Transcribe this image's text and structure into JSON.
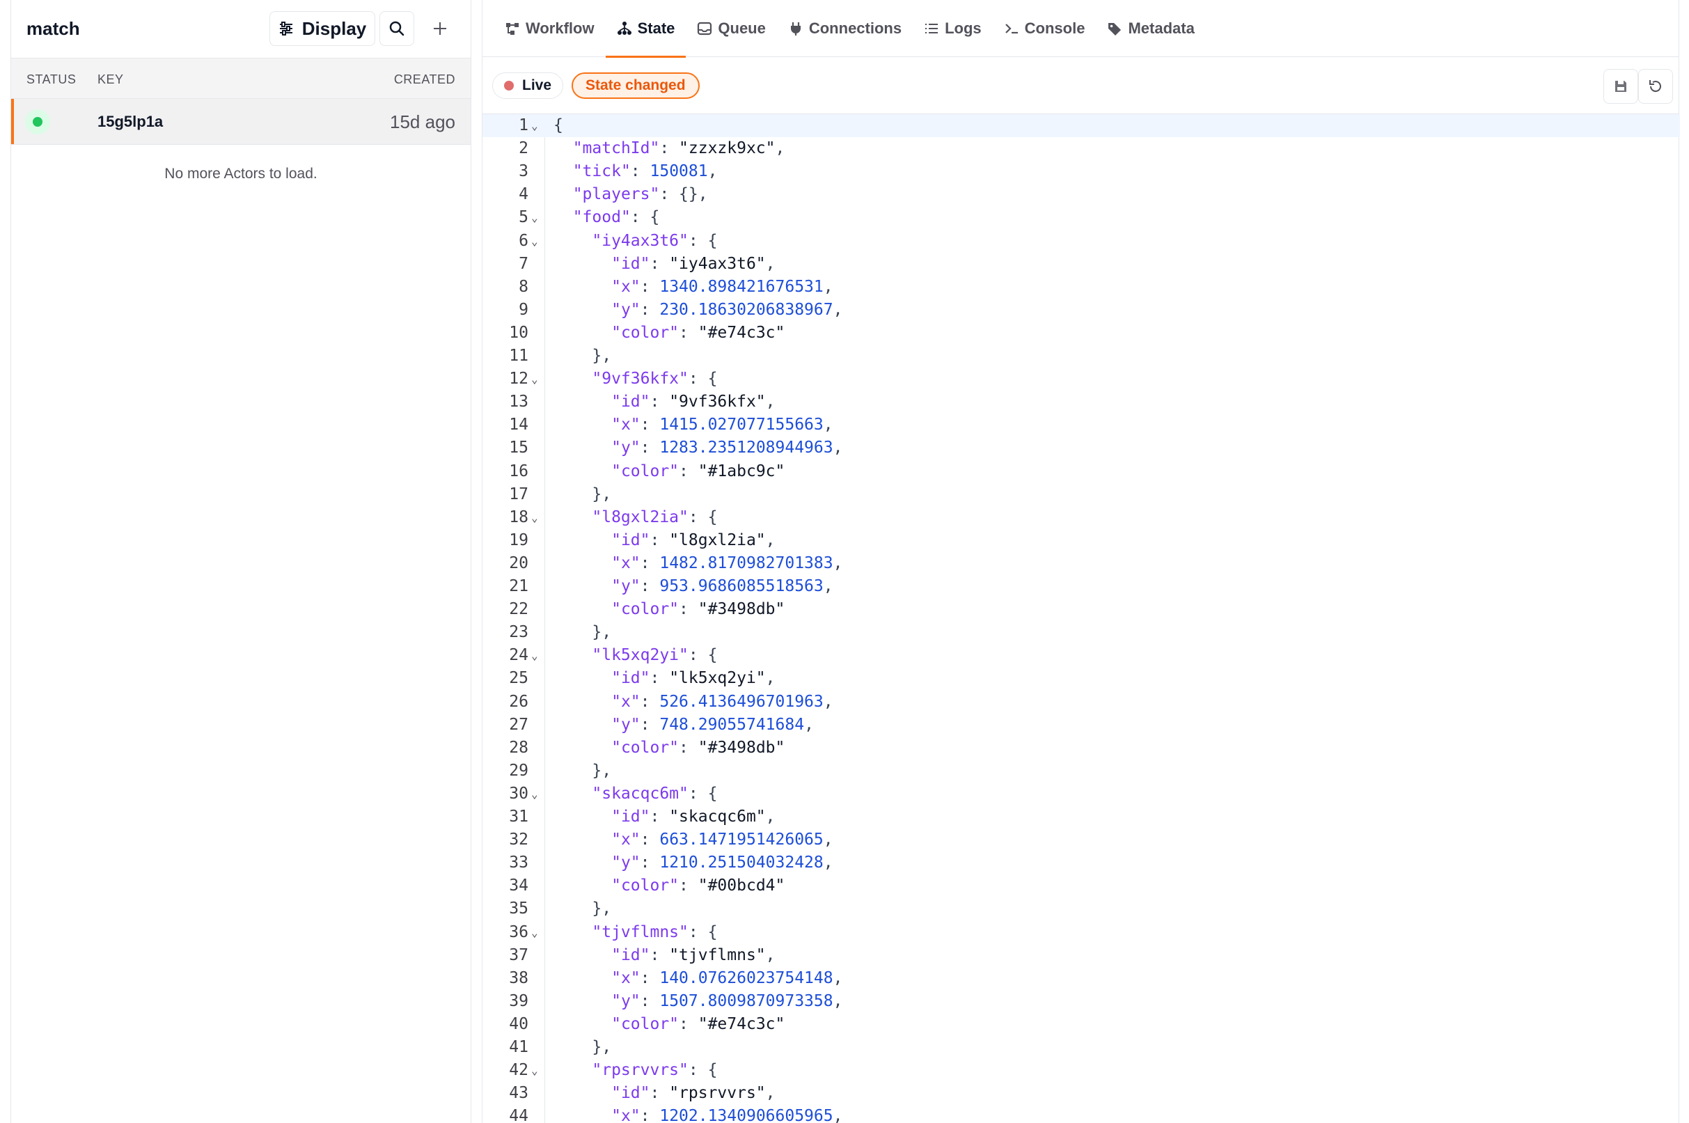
{
  "actors_panel": {
    "title": "match",
    "display_label": "Display",
    "columns": {
      "status": "STATUS",
      "key": "KEY",
      "created": "CREATED"
    },
    "rows": [
      {
        "key": "15g5lp1a",
        "created": "15d ago",
        "status": "running"
      }
    ],
    "empty_message": "No more Actors to load."
  },
  "tabs": [
    {
      "label": "Workflow",
      "icon": "workflow-icon"
    },
    {
      "label": "State",
      "icon": "state-icon",
      "active": true
    },
    {
      "label": "Queue",
      "icon": "queue-icon"
    },
    {
      "label": "Connections",
      "icon": "plug-icon"
    },
    {
      "label": "Logs",
      "icon": "list-icon"
    },
    {
      "label": "Console",
      "icon": "terminal-icon"
    },
    {
      "label": "Metadata",
      "icon": "tag-icon"
    }
  ],
  "toolbar": {
    "live_label": "Live",
    "changed_label": "State changed",
    "save_icon": "save-icon",
    "revert_icon": "revert-icon"
  },
  "editor": {
    "current_line": 1,
    "lines": [
      {
        "n": "1",
        "fold": true,
        "indent": 0,
        "t": [
          [
            "p",
            "{"
          ]
        ]
      },
      {
        "n": "2",
        "indent": 1,
        "t": [
          [
            "k",
            "\"matchId\""
          ],
          [
            "p",
            ": "
          ],
          [
            "s",
            "\"zzxzk9xc\""
          ],
          [
            "p",
            ","
          ]
        ]
      },
      {
        "n": "3",
        "indent": 1,
        "t": [
          [
            "k",
            "\"tick\""
          ],
          [
            "p",
            ": "
          ],
          [
            "n",
            "150081"
          ],
          [
            "p",
            ","
          ]
        ]
      },
      {
        "n": "4",
        "indent": 1,
        "t": [
          [
            "k",
            "\"players\""
          ],
          [
            "p",
            ": {},"
          ]
        ]
      },
      {
        "n": "5",
        "fold": true,
        "indent": 1,
        "t": [
          [
            "k",
            "\"food\""
          ],
          [
            "p",
            ": {"
          ]
        ]
      },
      {
        "n": "6",
        "fold": true,
        "indent": 2,
        "t": [
          [
            "k",
            "\"iy4ax3t6\""
          ],
          [
            "p",
            ": {"
          ]
        ]
      },
      {
        "n": "7",
        "indent": 3,
        "t": [
          [
            "k",
            "\"id\""
          ],
          [
            "p",
            ": "
          ],
          [
            "s",
            "\"iy4ax3t6\""
          ],
          [
            "p",
            ","
          ]
        ]
      },
      {
        "n": "8",
        "indent": 3,
        "t": [
          [
            "k",
            "\"x\""
          ],
          [
            "p",
            ": "
          ],
          [
            "n",
            "1340.898421676531"
          ],
          [
            "p",
            ","
          ]
        ]
      },
      {
        "n": "9",
        "indent": 3,
        "t": [
          [
            "k",
            "\"y\""
          ],
          [
            "p",
            ": "
          ],
          [
            "n",
            "230.18630206838967"
          ],
          [
            "p",
            ","
          ]
        ]
      },
      {
        "n": "10",
        "indent": 3,
        "t": [
          [
            "k",
            "\"color\""
          ],
          [
            "p",
            ": "
          ],
          [
            "s",
            "\"#e74c3c\""
          ]
        ]
      },
      {
        "n": "11",
        "indent": 2,
        "t": [
          [
            "p",
            "},"
          ]
        ]
      },
      {
        "n": "12",
        "fold": true,
        "indent": 2,
        "t": [
          [
            "k",
            "\"9vf36kfx\""
          ],
          [
            "p",
            ": {"
          ]
        ]
      },
      {
        "n": "13",
        "indent": 3,
        "t": [
          [
            "k",
            "\"id\""
          ],
          [
            "p",
            ": "
          ],
          [
            "s",
            "\"9vf36kfx\""
          ],
          [
            "p",
            ","
          ]
        ]
      },
      {
        "n": "14",
        "indent": 3,
        "t": [
          [
            "k",
            "\"x\""
          ],
          [
            "p",
            ": "
          ],
          [
            "n",
            "1415.027077155663"
          ],
          [
            "p",
            ","
          ]
        ]
      },
      {
        "n": "15",
        "indent": 3,
        "t": [
          [
            "k",
            "\"y\""
          ],
          [
            "p",
            ": "
          ],
          [
            "n",
            "1283.2351208944963"
          ],
          [
            "p",
            ","
          ]
        ]
      },
      {
        "n": "16",
        "indent": 3,
        "t": [
          [
            "k",
            "\"color\""
          ],
          [
            "p",
            ": "
          ],
          [
            "s",
            "\"#1abc9c\""
          ]
        ]
      },
      {
        "n": "17",
        "indent": 2,
        "t": [
          [
            "p",
            "},"
          ]
        ]
      },
      {
        "n": "18",
        "fold": true,
        "indent": 2,
        "t": [
          [
            "k",
            "\"l8gxl2ia\""
          ],
          [
            "p",
            ": {"
          ]
        ]
      },
      {
        "n": "19",
        "indent": 3,
        "t": [
          [
            "k",
            "\"id\""
          ],
          [
            "p",
            ": "
          ],
          [
            "s",
            "\"l8gxl2ia\""
          ],
          [
            "p",
            ","
          ]
        ]
      },
      {
        "n": "20",
        "indent": 3,
        "t": [
          [
            "k",
            "\"x\""
          ],
          [
            "p",
            ": "
          ],
          [
            "n",
            "1482.8170982701383"
          ],
          [
            "p",
            ","
          ]
        ]
      },
      {
        "n": "21",
        "indent": 3,
        "t": [
          [
            "k",
            "\"y\""
          ],
          [
            "p",
            ": "
          ],
          [
            "n",
            "953.9686085518563"
          ],
          [
            "p",
            ","
          ]
        ]
      },
      {
        "n": "22",
        "indent": 3,
        "t": [
          [
            "k",
            "\"color\""
          ],
          [
            "p",
            ": "
          ],
          [
            "s",
            "\"#3498db\""
          ]
        ]
      },
      {
        "n": "23",
        "indent": 2,
        "t": [
          [
            "p",
            "},"
          ]
        ]
      },
      {
        "n": "24",
        "fold": true,
        "indent": 2,
        "t": [
          [
            "k",
            "\"lk5xq2yi\""
          ],
          [
            "p",
            ": {"
          ]
        ]
      },
      {
        "n": "25",
        "indent": 3,
        "t": [
          [
            "k",
            "\"id\""
          ],
          [
            "p",
            ": "
          ],
          [
            "s",
            "\"lk5xq2yi\""
          ],
          [
            "p",
            ","
          ]
        ]
      },
      {
        "n": "26",
        "indent": 3,
        "t": [
          [
            "k",
            "\"x\""
          ],
          [
            "p",
            ": "
          ],
          [
            "n",
            "526.4136496701963"
          ],
          [
            "p",
            ","
          ]
        ]
      },
      {
        "n": "27",
        "indent": 3,
        "t": [
          [
            "k",
            "\"y\""
          ],
          [
            "p",
            ": "
          ],
          [
            "n",
            "748.29055741684"
          ],
          [
            "p",
            ","
          ]
        ]
      },
      {
        "n": "28",
        "indent": 3,
        "t": [
          [
            "k",
            "\"color\""
          ],
          [
            "p",
            ": "
          ],
          [
            "s",
            "\"#3498db\""
          ]
        ]
      },
      {
        "n": "29",
        "indent": 2,
        "t": [
          [
            "p",
            "},"
          ]
        ]
      },
      {
        "n": "30",
        "fold": true,
        "indent": 2,
        "t": [
          [
            "k",
            "\"skacqc6m\""
          ],
          [
            "p",
            ": {"
          ]
        ]
      },
      {
        "n": "31",
        "indent": 3,
        "t": [
          [
            "k",
            "\"id\""
          ],
          [
            "p",
            ": "
          ],
          [
            "s",
            "\"skacqc6m\""
          ],
          [
            "p",
            ","
          ]
        ]
      },
      {
        "n": "32",
        "indent": 3,
        "t": [
          [
            "k",
            "\"x\""
          ],
          [
            "p",
            ": "
          ],
          [
            "n",
            "663.1471951426065"
          ],
          [
            "p",
            ","
          ]
        ]
      },
      {
        "n": "33",
        "indent": 3,
        "t": [
          [
            "k",
            "\"y\""
          ],
          [
            "p",
            ": "
          ],
          [
            "n",
            "1210.251504032428"
          ],
          [
            "p",
            ","
          ]
        ]
      },
      {
        "n": "34",
        "indent": 3,
        "t": [
          [
            "k",
            "\"color\""
          ],
          [
            "p",
            ": "
          ],
          [
            "s",
            "\"#00bcd4\""
          ]
        ]
      },
      {
        "n": "35",
        "indent": 2,
        "t": [
          [
            "p",
            "},"
          ]
        ]
      },
      {
        "n": "36",
        "fold": true,
        "indent": 2,
        "t": [
          [
            "k",
            "\"tjvflmns\""
          ],
          [
            "p",
            ": {"
          ]
        ]
      },
      {
        "n": "37",
        "indent": 3,
        "t": [
          [
            "k",
            "\"id\""
          ],
          [
            "p",
            ": "
          ],
          [
            "s",
            "\"tjvflmns\""
          ],
          [
            "p",
            ","
          ]
        ]
      },
      {
        "n": "38",
        "indent": 3,
        "t": [
          [
            "k",
            "\"x\""
          ],
          [
            "p",
            ": "
          ],
          [
            "n",
            "140.07626023754148"
          ],
          [
            "p",
            ","
          ]
        ]
      },
      {
        "n": "39",
        "indent": 3,
        "t": [
          [
            "k",
            "\"y\""
          ],
          [
            "p",
            ": "
          ],
          [
            "n",
            "1507.8009870973358"
          ],
          [
            "p",
            ","
          ]
        ]
      },
      {
        "n": "40",
        "indent": 3,
        "t": [
          [
            "k",
            "\"color\""
          ],
          [
            "p",
            ": "
          ],
          [
            "s",
            "\"#e74c3c\""
          ]
        ]
      },
      {
        "n": "41",
        "indent": 2,
        "t": [
          [
            "p",
            "},"
          ]
        ]
      },
      {
        "n": "42",
        "fold": true,
        "indent": 2,
        "t": [
          [
            "k",
            "\"rpsrvvrs\""
          ],
          [
            "p",
            ": {"
          ]
        ]
      },
      {
        "n": "43",
        "indent": 3,
        "t": [
          [
            "k",
            "\"id\""
          ],
          [
            "p",
            ": "
          ],
          [
            "s",
            "\"rpsrvvrs\""
          ],
          [
            "p",
            ","
          ]
        ]
      },
      {
        "n": "44",
        "indent": 3,
        "t": [
          [
            "k",
            "\"x\""
          ],
          [
            "p",
            ": "
          ],
          [
            "n",
            "1202.1340906605965"
          ],
          [
            "p",
            ","
          ]
        ]
      }
    ]
  }
}
